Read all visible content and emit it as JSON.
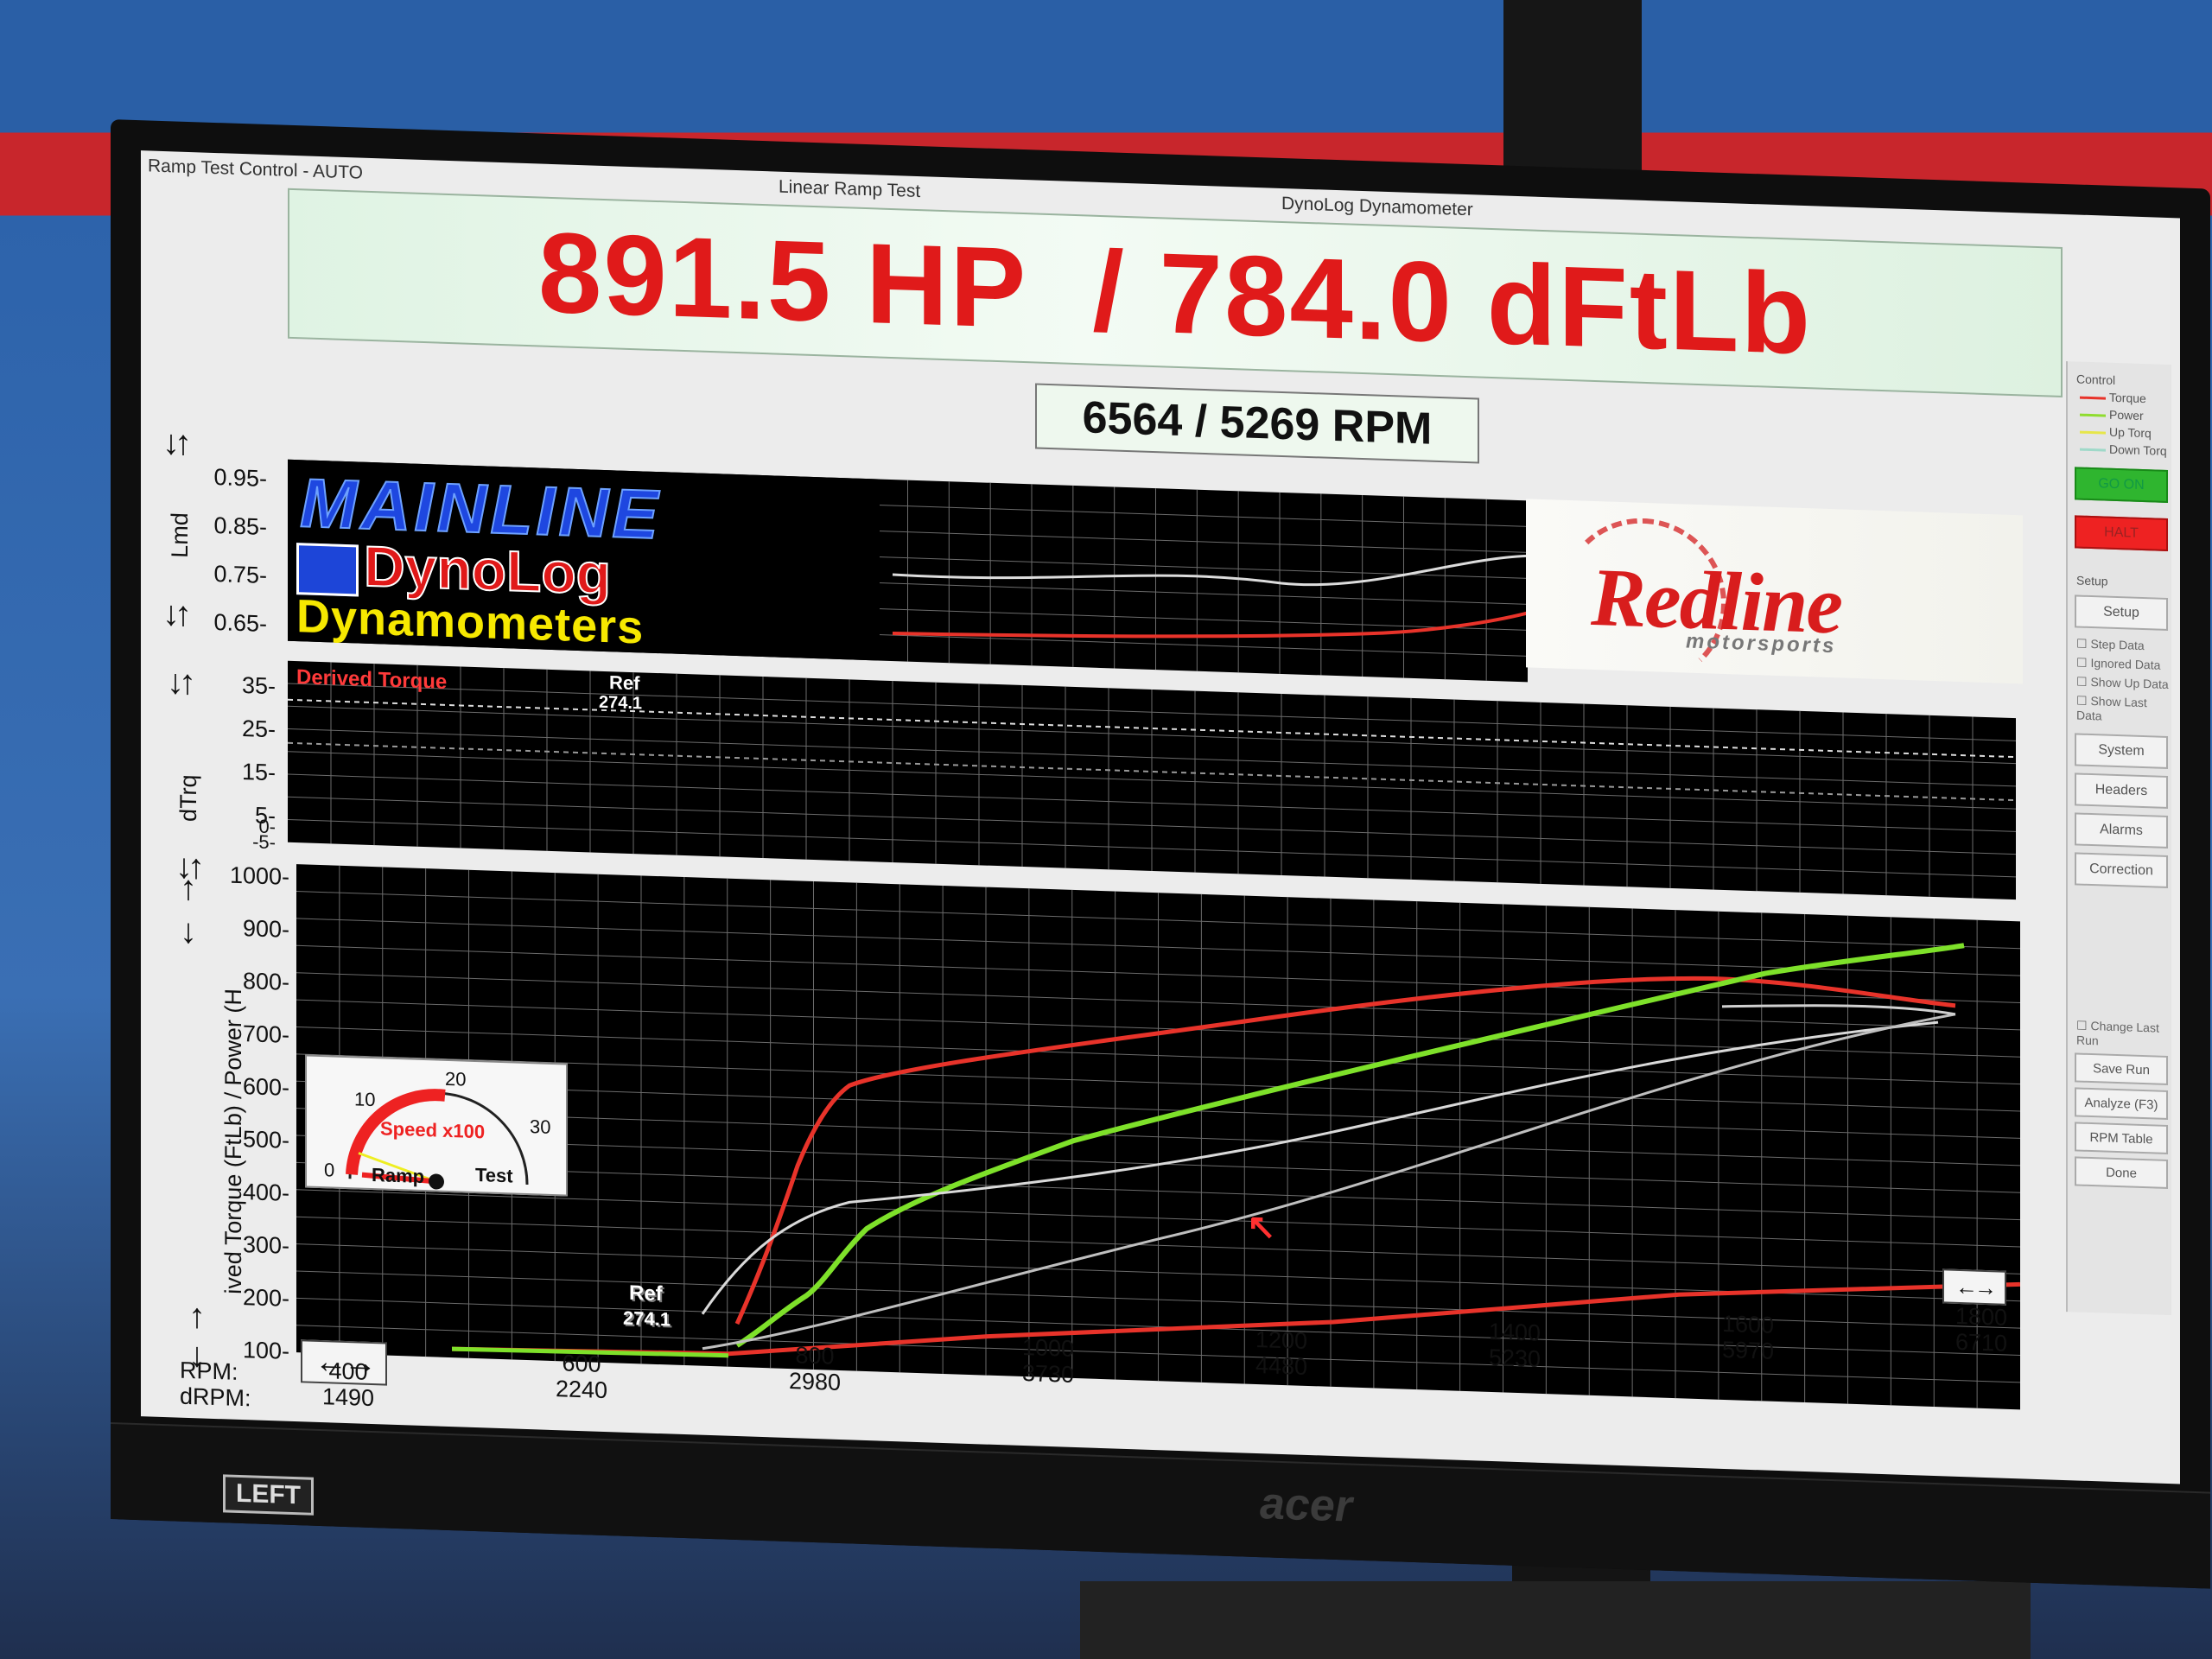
{
  "window": {
    "title_left": "Ramp Test Control - AUTO",
    "title_center": "Linear Ramp Test",
    "title_right": "DynoLog Dynamometer"
  },
  "readout": {
    "main": "891.5 HP  / 784.0 dFtLb",
    "rpm": "6564 / 5269 RPM"
  },
  "logos": {
    "mainline": "MAINLINE",
    "dynolog": "DynoLog",
    "dynamometers": "Dynamometers",
    "redline": "Redline",
    "redline_sub": "motorsports"
  },
  "lmd_panel": {
    "axis_label": "Lmd",
    "ticks": [
      "0.95",
      "0.85",
      "0.75",
      "0.65"
    ]
  },
  "dtrq_panel": {
    "axis_label": "dTrq",
    "series_label": "Derived Torque",
    "ref_label": "Ref",
    "ref_value": "274.1",
    "ticks": [
      "35",
      "25",
      "15",
      "5",
      "0",
      "-5"
    ]
  },
  "main_panel": {
    "axis_label": "ived Torque (FtLb) / Power (H",
    "ticks": [
      "1000",
      "900",
      "800",
      "700",
      "600",
      "500",
      "400",
      "300",
      "200",
      "100"
    ],
    "ref_label": "Ref",
    "ref_value": "274.1",
    "x_row_label": "RPM:",
    "x2_row_label": "dRPM:",
    "x_ticks": [
      {
        "rpm": "400",
        "drpm": "1490"
      },
      {
        "rpm": "600",
        "drpm": "2240"
      },
      {
        "rpm": "800",
        "drpm": "2980"
      },
      {
        "rpm": "1000",
        "drpm": "3730"
      },
      {
        "rpm": "1200",
        "drpm": "4480"
      },
      {
        "rpm": "1400",
        "drpm": "5230"
      },
      {
        "rpm": "1600",
        "drpm": "5970"
      },
      {
        "rpm": "1800",
        "drpm": "6710"
      }
    ]
  },
  "gauge": {
    "label": "Speed x100",
    "n0": "0",
    "n10": "10",
    "n20": "20",
    "n30": "30",
    "left_word": "Ramp",
    "right_word": "Test"
  },
  "sidebar": {
    "control_title": "Control",
    "legend": [
      "Torque",
      "Power",
      "Up Torq",
      "Down Torq"
    ],
    "legend_colors": [
      "#e8332a",
      "#8fdc2f",
      "#e6e64a",
      "#9fd9c9"
    ],
    "btn_go": "GO ON",
    "btn_halt": "HALT",
    "setup_title": "Setup",
    "setup_btn": "Setup",
    "checks": [
      "Step Data",
      "Ignored Data",
      "Show Up Data",
      "Show Last Data"
    ],
    "buttons": [
      "System",
      "Headers",
      "Alarms",
      "Correction"
    ],
    "lower_check": "Change Last Run",
    "lower_buttons": [
      "Save Run",
      "Analyze (F3)",
      "RPM Table",
      "Done"
    ]
  },
  "monitor": {
    "brand": "acer",
    "sticker_tag": "LEFT"
  },
  "colors": {
    "torque": "#e8332a",
    "power": "#7ee12a",
    "reference": "#d9d9d9",
    "banner_text": "#e01a1a"
  }
}
